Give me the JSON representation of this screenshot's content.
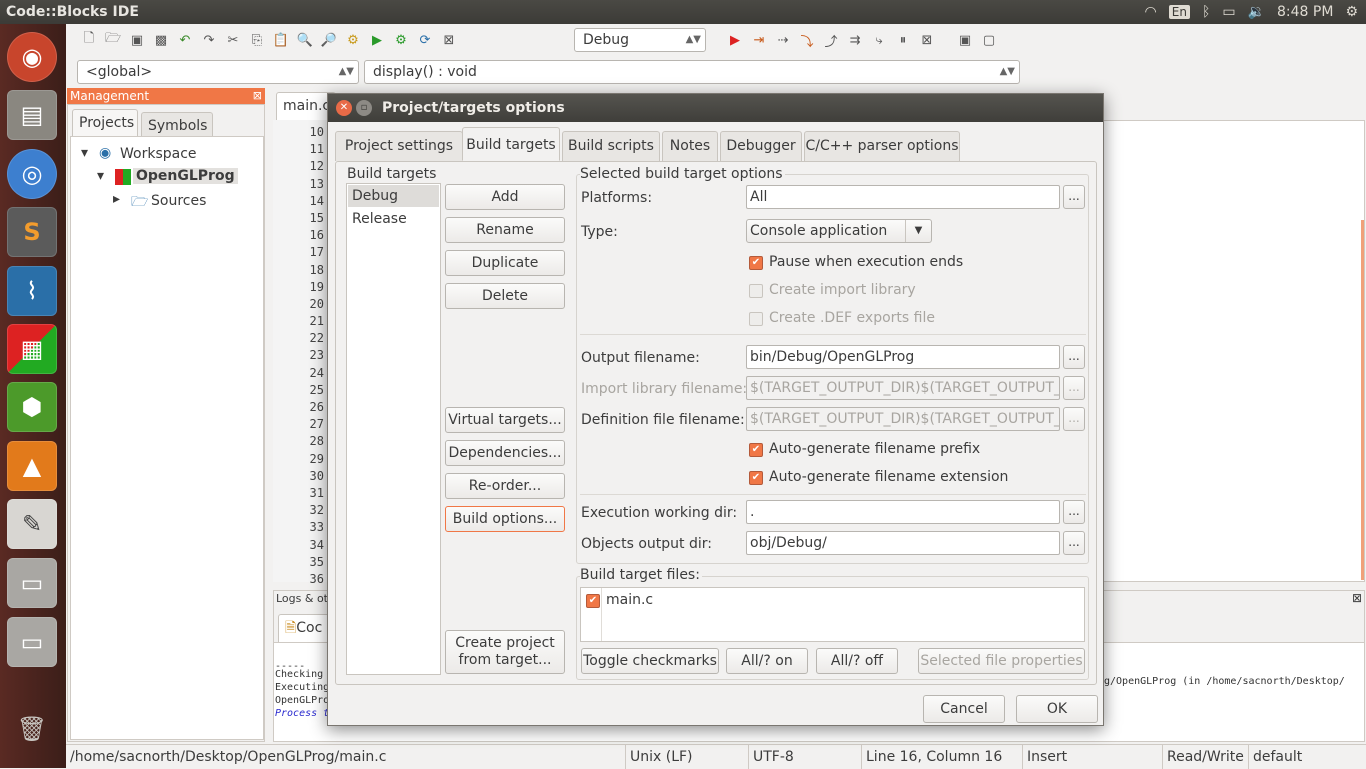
{
  "app": {
    "title": "Code::Blocks IDE"
  },
  "tray": {
    "lang": "En",
    "time": "8:48 PM"
  },
  "toolbar": {
    "build_target": "Debug"
  },
  "code_nav": {
    "scope": "<global>",
    "function": "display() : void"
  },
  "management": {
    "title": "Management",
    "tabs": [
      "Projects",
      "Symbols"
    ],
    "tree": {
      "workspace": "Workspace",
      "project": "OpenGLProg",
      "sources": "Sources"
    }
  },
  "editor": {
    "tab": "main.c",
    "line_numbers": [
      "10",
      "11",
      "12",
      "13",
      "14",
      "15",
      "16",
      "17",
      "18",
      "19",
      "20",
      "21",
      "22",
      "23",
      "24",
      "25",
      "26",
      "27",
      "28",
      "29",
      "30",
      "31",
      "32",
      "33",
      "34",
      "35",
      "36"
    ]
  },
  "logs": {
    "title": "Logs & ot",
    "tab": "Coc",
    "lines": [
      "Checking",
      "Executing",
      "OpenGLPro",
      "Process t"
    ],
    "right_text": "g/OpenGLProg  (in /home/sacnorth/Desktop/"
  },
  "status": {
    "path": "/home/sacnorth/Desktop/OpenGLProg/main.c",
    "eol": "Unix (LF)",
    "encoding": "UTF-8",
    "position": "Line 16, Column 16",
    "mode": "Insert",
    "access": "Read/Write",
    "lang": "default"
  },
  "dialog": {
    "title": "Project/targets options",
    "tabs": [
      "Project settings",
      "Build targets",
      "Build scripts",
      "Notes",
      "Debugger",
      "C/C++ parser options"
    ],
    "build_targets_label": "Build targets",
    "targets": [
      "Debug",
      "Release"
    ],
    "buttons": {
      "add": "Add",
      "rename": "Rename",
      "duplicate": "Duplicate",
      "delete": "Delete",
      "virtual": "Virtual targets...",
      "dependencies": "Dependencies...",
      "reorder": "Re-order...",
      "build_options": "Build options...",
      "create_project_1": "Create project",
      "create_project_2": "from target..."
    },
    "options": {
      "group": "Selected build target options",
      "platforms_label": "Platforms:",
      "platforms_value": "All",
      "type_label": "Type:",
      "type_value": "Console application",
      "pause": "Pause when execution ends",
      "import_lib": "Create import library",
      "def_file": "Create .DEF exports file",
      "output_label": "Output filename:",
      "output_value": "bin/Debug/OpenGLProg",
      "import_label": "Import library filename:",
      "import_value": "$(TARGET_OUTPUT_DIR)$(TARGET_OUTPUT_B",
      "def_label": "Definition file filename:",
      "def_value": "$(TARGET_OUTPUT_DIR)$(TARGET_OUTPUT_B",
      "prefix": "Auto-generate filename prefix",
      "extension": "Auto-generate filename extension",
      "workdir_label": "Execution working dir:",
      "workdir_value": ".",
      "objdir_label": "Objects output dir:",
      "objdir_value": "obj/Debug/",
      "ellipsis": "..."
    },
    "files": {
      "group": "Build target files:",
      "items": [
        "main.c"
      ],
      "toggle": "Toggle checkmarks",
      "all_on": "All/? on",
      "all_off": "All/? off",
      "props": "Selected file properties"
    },
    "cancel": "Cancel",
    "ok": "OK"
  }
}
